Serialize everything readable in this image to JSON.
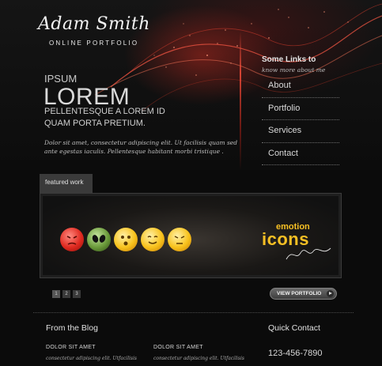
{
  "header": {
    "logo_signature": "Adam Smith",
    "logo_subtitle": "ONLINE PORTFOLIO"
  },
  "hero": {
    "kicker": "IPSUM",
    "headline": "LOREM",
    "subline_1": "PELLENTESQUE A LOREM ID",
    "subline_2": "QUAM PORTA PRETIUM.",
    "body": "Dolor sit amet, consectetur adipiscing elit. Ut facilisis quam sed ante egestas iaculis. Pellentesque habitant morbi tristique ."
  },
  "sidebar": {
    "title": "Some Links to",
    "subtitle": "know more about me",
    "items": [
      {
        "label": "About"
      },
      {
        "label": "Portfolio"
      },
      {
        "label": "Services"
      },
      {
        "label": "Contact"
      }
    ]
  },
  "featured": {
    "tab_label": "featured work",
    "slide_word_1": "emotion",
    "slide_word_2": "icons",
    "icons": [
      "angry-red-face-icon",
      "alien-green-face-icon",
      "surprised-face-icon",
      "smiling-face-icon",
      "annoyed-face-icon"
    ],
    "pager": [
      "1",
      "2",
      "3"
    ],
    "view_button": "VIEW PORTFOLIO"
  },
  "blog": {
    "title": "From the Blog",
    "posts": [
      {
        "title": "DOLOR SIT AMET",
        "excerpt": "consectetur adipiscing elit. Utfacilisis"
      },
      {
        "title": "DOLOR SIT AMET",
        "excerpt": "consectetur adipiscing elit. Utfacilisis"
      }
    ]
  },
  "quick_contact": {
    "title": "Quick Contact",
    "phone": "123-456-7890"
  },
  "colors": {
    "accent_red": "#c0281c",
    "accent_gold": "#f7c024",
    "background": "#0b0b0b"
  }
}
